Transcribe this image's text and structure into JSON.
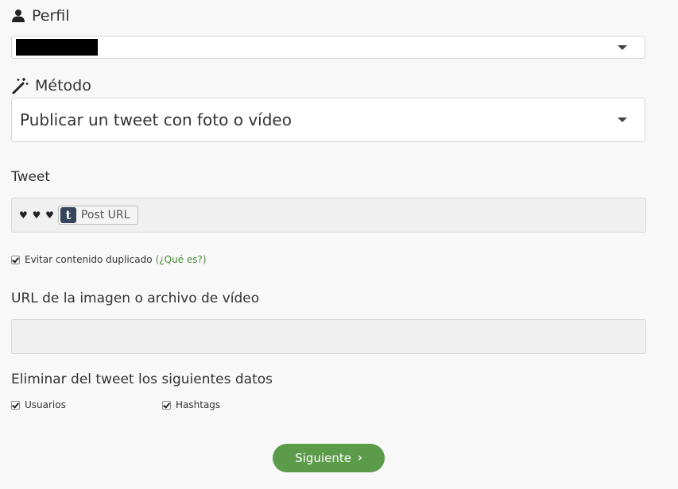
{
  "profile": {
    "title": "Perfil",
    "icon": "user-icon"
  },
  "method": {
    "title": "Método",
    "icon": "magic-wand-icon",
    "selected": "Publicar un tweet con foto o vídeo"
  },
  "tweet": {
    "label": "Tweet",
    "hearts": "♥ ♥ ♥",
    "token_icon": "tumblr-icon",
    "token_icon_glyph": "t",
    "token_label": "Post URL"
  },
  "avoid_duplicate": {
    "label": "Evitar contenido duplicado",
    "link": "(¿Qué es?)",
    "checked": true
  },
  "media_url": {
    "label": "URL de la imagen o archivo de vídeo",
    "value": ""
  },
  "remove_data": {
    "label": "Eliminar del tweet los siguientes datos",
    "options": [
      {
        "label": "Usuarios",
        "checked": true
      },
      {
        "label": "Hashtags",
        "checked": true
      }
    ]
  },
  "next_button": {
    "label": "Siguiente",
    "chevron": "›"
  },
  "colors": {
    "accent": "#5b9b4a",
    "link": "#4a8b3a",
    "tumblr": "#35465c"
  }
}
